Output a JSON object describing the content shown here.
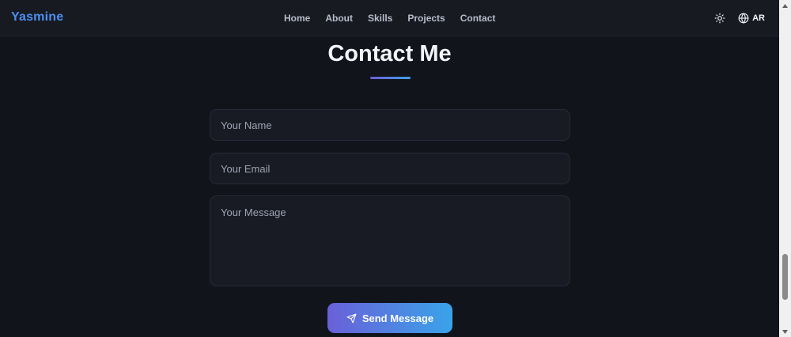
{
  "navbar": {
    "brand": "Yasmine",
    "links": [
      {
        "label": "Home"
      },
      {
        "label": "About"
      },
      {
        "label": "Skills"
      },
      {
        "label": "Projects"
      },
      {
        "label": "Contact"
      }
    ],
    "theme_icon": "sun-icon",
    "language_icon": "globe-icon",
    "language_label": "AR"
  },
  "contact": {
    "title": "Contact Me",
    "name_placeholder": "Your Name",
    "email_placeholder": "Your Email",
    "message_placeholder": "Your Message",
    "send_label": "Send Message",
    "send_icon": "send-icon"
  },
  "colors": {
    "background": "#12141c",
    "navbar": "#181a22",
    "brand": "#4a8ff0",
    "accent_start": "#6a60d8",
    "accent_end": "#3aa3ea",
    "field_background": "#191b24"
  }
}
